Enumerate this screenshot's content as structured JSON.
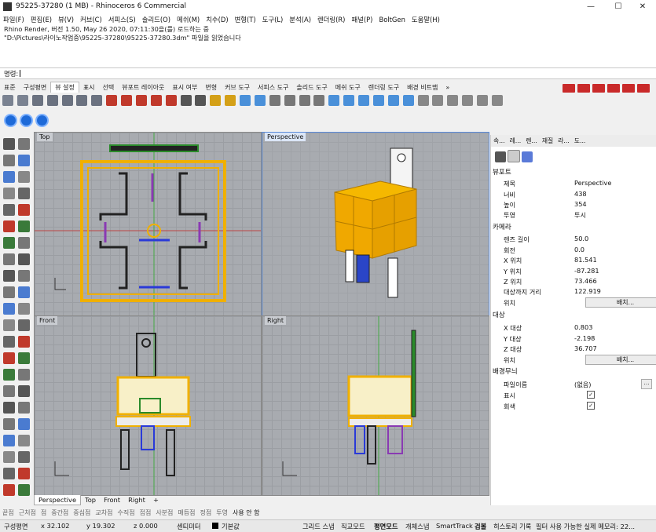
{
  "window": {
    "title": "95225-37280 (1 MB) - Rhinoceros 6 Commercial",
    "minimize": "—",
    "maximize": "☐",
    "close": "✕"
  },
  "menu": [
    "파일(F)",
    "편집(E)",
    "뷰(V)",
    "커브(C)",
    "서피스(S)",
    "솔리드(O)",
    "메쉬(M)",
    "치수(D)",
    "변형(T)",
    "도구(L)",
    "분석(A)",
    "렌더링(R)",
    "패널(P)",
    "BoltGen",
    "도움말(H)"
  ],
  "history": [
    "Rhino Render, 버전 1.50, May 26 2020, 07:11:30을(를) 로드하는 중",
    "\"D:\\Pictures\\라이노작업중\\95225-37280\\95225-37280.3dm\" 파일을 읽었습니다"
  ],
  "command": {
    "label": "명령:"
  },
  "toolbar_tabs": [
    "표준",
    "구성평면",
    "뷰 설정",
    "표시",
    "선택",
    "뷰포트 레이아웃",
    "표시 여부",
    "변형",
    "커브 도구",
    "서피스 도구",
    "솔리드 도구",
    "메쉬 도구",
    "렌더링 도구",
    "배경 비트맵",
    "»"
  ],
  "viewports": {
    "top": "Top",
    "perspective": "Perspective",
    "front": "Front",
    "right": "Right"
  },
  "viewport_tabs": [
    "Perspective",
    "Top",
    "Front",
    "Right",
    "+"
  ],
  "panel": {
    "tabs": [
      "속...",
      "레...",
      "렌...",
      "재질",
      "라...",
      "도..."
    ],
    "viewport_section": "뷰포트",
    "title_k": "제목",
    "title_v": "Perspective",
    "width_k": "너비",
    "width_v": "438",
    "height_k": "높이",
    "height_v": "354",
    "proj_k": "투영",
    "proj_v": "투시",
    "camera_section": "카메라",
    "lens_k": "렌즈 길이",
    "lens_v": "50.0",
    "rot_k": "회전",
    "rot_v": "0.0",
    "xpos_k": "X 위치",
    "xpos_v": "81.541",
    "ypos_k": "Y 위치",
    "ypos_v": "-87.281",
    "zpos_k": "Z 위치",
    "zpos_v": "73.466",
    "dist_k": "대상까지 거리",
    "dist_v": "122.919",
    "pos_k": "위치",
    "place_btn": "배치...",
    "target_section": "대상",
    "xt_k": "X 대상",
    "xt_v": "0.803",
    "yt_k": "Y 대상",
    "yt_v": "-2.198",
    "zt_k": "Z 대상",
    "zt_v": "36.707",
    "tpos_k": "위치",
    "tplace_btn": "배치...",
    "bg_section": "배경무늬",
    "file_k": "파일이름",
    "file_v": "(없음)",
    "show_k": "표시",
    "gray_k": "회색"
  },
  "osnap": [
    "끝점",
    "근처점",
    "점",
    "중간점",
    "중심점",
    "교차점",
    "수직점",
    "접점",
    "사분점",
    "매듭점",
    "정점",
    "투영",
    "사용 안 함"
  ],
  "status": {
    "cplane": "구성평면",
    "x": "x 32.102",
    "y": "y 19.302",
    "z": "z 0.000",
    "unit": "센티미터",
    "layer": "기본값",
    "grid_snap": "그리드 스냅",
    "ortho": "직교모드",
    "planar": "평면모드",
    "osnap": "개체스냅",
    "smarttrack": "SmartTrack",
    "gumball": "검볼",
    "history": "히스토리 기록",
    "memory": "필터  사용 가능한 실제 메모리: 22..."
  }
}
